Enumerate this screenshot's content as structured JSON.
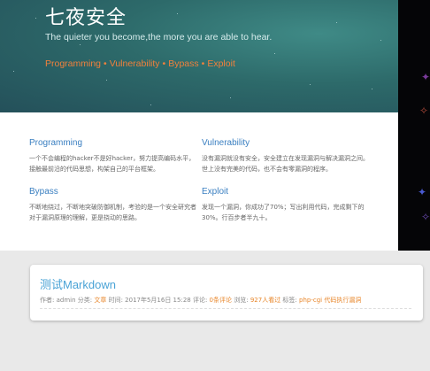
{
  "header": {
    "site_title": "七夜安全",
    "motto": "The quieter you become,the more you are able to hear.",
    "topics": [
      "Programming",
      "Vulnerability",
      "Bypass",
      "Exploit"
    ],
    "separator": "•"
  },
  "features": [
    {
      "title": "Programming",
      "text": "一个不会编程的hacker不是好hacker，努力提高编码水平，接触最前沿的代码思想，构架自己的平台框架。"
    },
    {
      "title": "Vulnerability",
      "text": "没有漏洞就没有安全，安全建立在发现漏洞与解决漏洞之间。世上没有完美的代码，也不会有零漏洞的程序。"
    },
    {
      "title": "Bypass",
      "text": "不断地绕过，不断地突破防御机制，考验的是一个安全研究者对于漏洞原理的理解，更是挠动的思路。"
    },
    {
      "title": "Exploit",
      "text": "发现一个漏洞，你成功了70%；写出利用代码，完成剩下的30%。行百步者半九十。"
    }
  ],
  "post": {
    "title": "测试Markdown",
    "author_label": "作者: ",
    "author": "admin",
    "category_label": " 分类: ",
    "category": "文章",
    "time_label": " 时间: ",
    "time": "2017年5月16日 15:28",
    "comments_label": " 评论: ",
    "comments": "0条评论",
    "views_label": " 浏览: ",
    "views": "927人看过",
    "tags_label": " 标签: ",
    "tags": "php-cgi 代码执行漏洞"
  },
  "colors": {
    "accent_orange": "#f0803c",
    "link_blue": "#3a7fc1",
    "hero_teal": "#2d6a6a"
  }
}
